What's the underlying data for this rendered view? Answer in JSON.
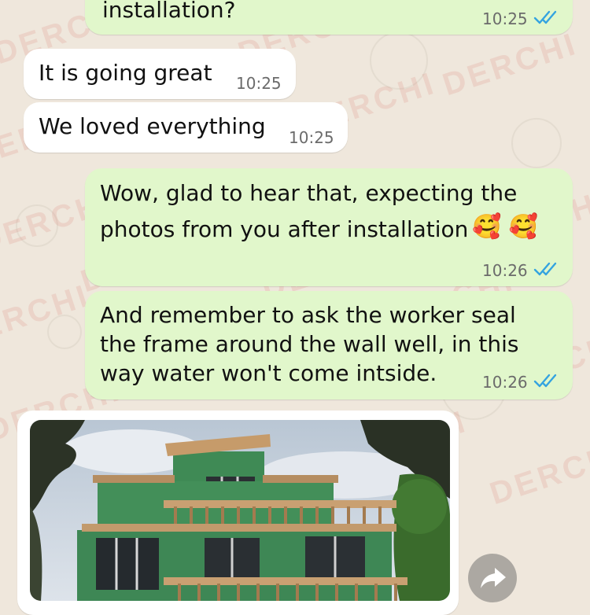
{
  "messages": [
    {
      "type": "out",
      "text": "installation?",
      "time": "10:25",
      "status": "read"
    },
    {
      "type": "in",
      "text": "It is going great",
      "time": "10:25"
    },
    {
      "type": "in",
      "text": "We loved everything",
      "time": "10:25"
    },
    {
      "type": "out",
      "line1": "Wow, glad to hear that, expecting the",
      "line2": "photos from you after installation",
      "emoji": "🥰 🥰",
      "time": "10:26",
      "status": "read"
    },
    {
      "type": "out",
      "line1": "And remember to ask the worker seal",
      "line2": "the frame around the wall well, in this",
      "line3": "way water won't come intside.",
      "time": "10:26",
      "status": "read"
    }
  ],
  "watermark": "DERCHI",
  "image_message": {
    "subject": "house-photo"
  },
  "colors": {
    "incoming_bubble": "#ffffff",
    "outgoing_bubble": "#e1f7cb",
    "read_ticks": "#34a3e0",
    "wallpaper": "#efe7dc"
  },
  "icons": {
    "forward": "forward-arrow-icon",
    "ticks": "double-check-icon"
  }
}
